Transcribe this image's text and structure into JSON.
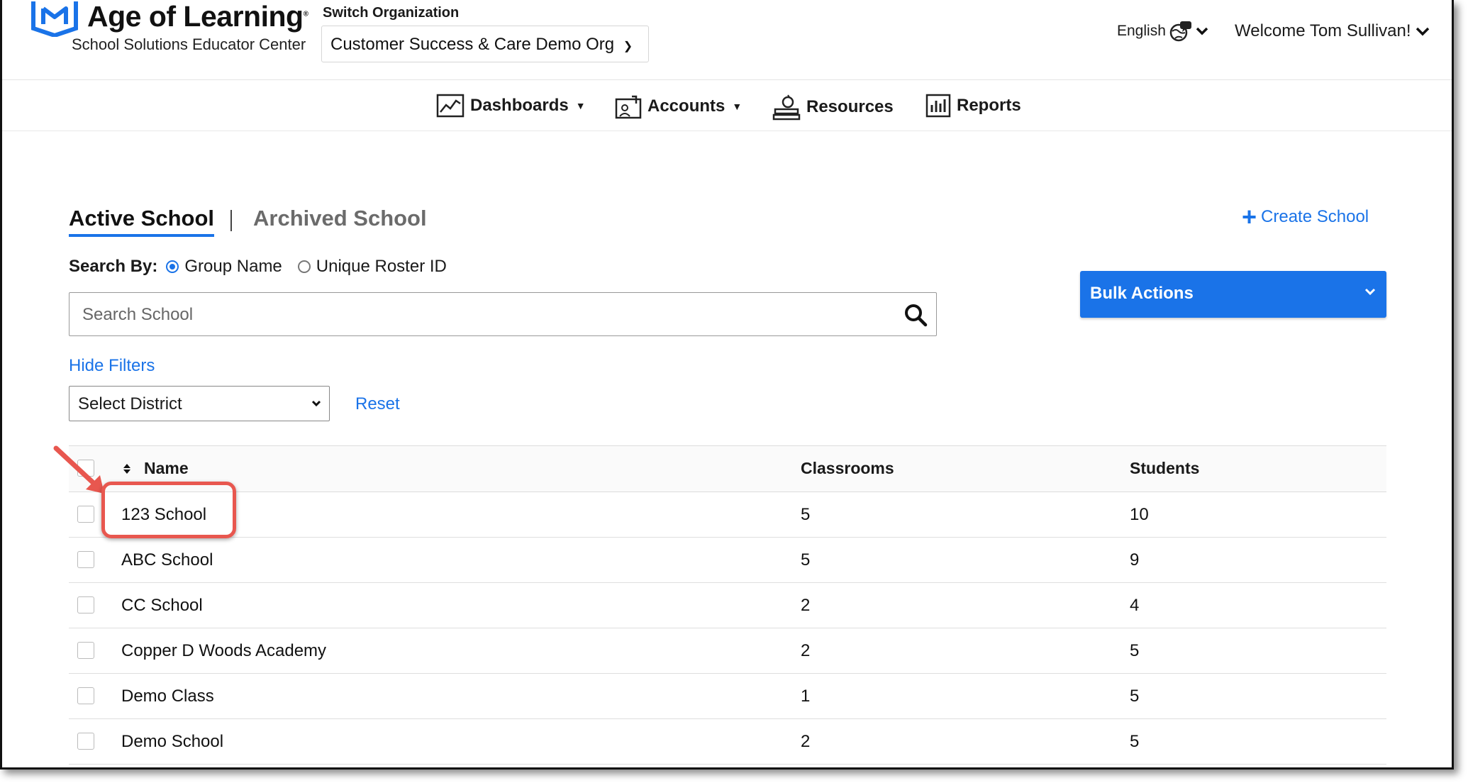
{
  "header": {
    "brand": "Age of Learning",
    "brand_sub": "School Solutions Educator Center",
    "switch_org_label": "Switch Organization",
    "org_selected": "Customer Success & Care Demo Org",
    "language": "English",
    "welcome": "Welcome Tom Sullivan!"
  },
  "nav": {
    "dashboards": "Dashboards",
    "accounts": "Accounts",
    "resources": "Resources",
    "reports": "Reports"
  },
  "tabs": {
    "active": "Active School",
    "archived": "Archived School"
  },
  "create_school": "Create School",
  "search": {
    "by_label": "Search By:",
    "option_group": "Group Name",
    "option_roster": "Unique Roster ID",
    "placeholder": "Search School"
  },
  "bulk_actions": "Bulk Actions",
  "filters": {
    "hide": "Hide Filters",
    "district": "Select District",
    "reset": "Reset"
  },
  "table": {
    "headers": {
      "name": "Name",
      "classrooms": "Classrooms",
      "students": "Students"
    },
    "rows": [
      {
        "name": "123 School",
        "classrooms": "5",
        "students": "10"
      },
      {
        "name": "ABC School",
        "classrooms": "5",
        "students": "9"
      },
      {
        "name": "CC School",
        "classrooms": "2",
        "students": "4"
      },
      {
        "name": "Copper D Woods Academy",
        "classrooms": "2",
        "students": "5"
      },
      {
        "name": "Demo Class",
        "classrooms": "1",
        "students": "5"
      },
      {
        "name": "Demo School",
        "classrooms": "2",
        "students": "5"
      }
    ]
  },
  "colors": {
    "accent": "#1a73e8",
    "annotation": "#e8574f"
  }
}
